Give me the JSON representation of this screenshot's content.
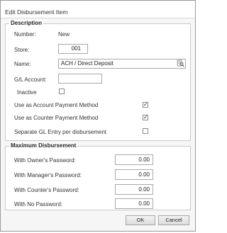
{
  "window": {
    "title": "Edit Disbursement Item"
  },
  "description": {
    "legend": "Description",
    "number_label": "Number:",
    "number_value": "New",
    "store_label": "Store:",
    "store_value": "001",
    "name_label": "Name:",
    "name_value": "ACH / Direct Deposit",
    "gl_label": "G/L Account:",
    "gl_value": "",
    "inactive_label": "Inactive",
    "account_payment_label": "Use as Account Payment Method",
    "counter_payment_label": "Use as Counter Payment Method",
    "separate_gl_label": "Separate GL Entry per disbursement",
    "inactive_checked": false,
    "account_payment_checked": true,
    "counter_payment_checked": true,
    "separate_gl_checked": false
  },
  "max_disbursement": {
    "legend": "Maximum Disbursement",
    "owner_label": "With Owner's Password:",
    "owner_value": "0.00",
    "manager_label": "With Manager's Password:",
    "manager_value": "0.00",
    "counter_label": "With Counter's Password:",
    "counter_value": "0.00",
    "nopass_label": "With No Password:",
    "nopass_value": "0.00"
  },
  "buttons": {
    "ok": "OK",
    "cancel": "Cancel"
  },
  "icons": {
    "lookup": "lookup-icon"
  }
}
